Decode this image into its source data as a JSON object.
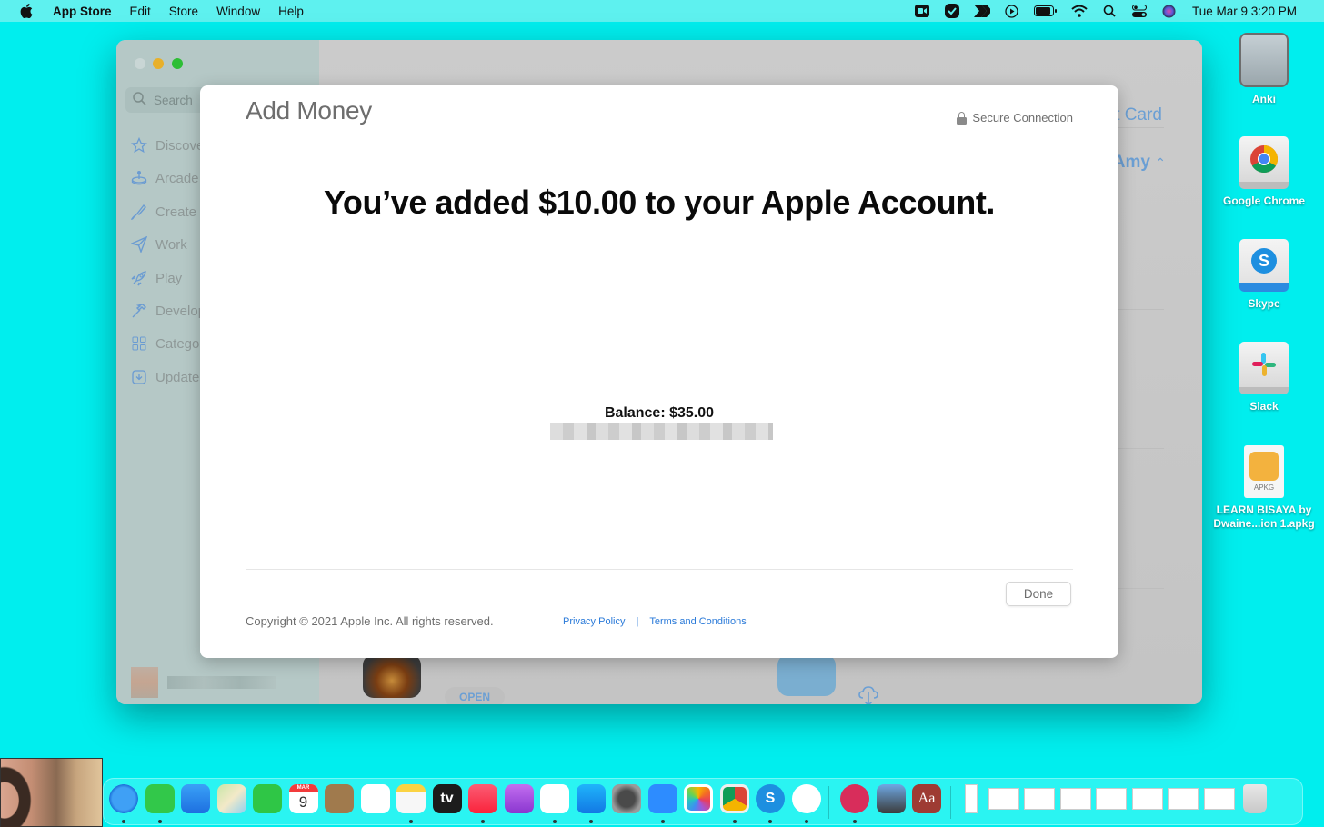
{
  "menubar": {
    "app_name": "App Store",
    "items": [
      "Edit",
      "Store",
      "Window",
      "Help"
    ],
    "clock": "Tue Mar 9  3:20 PM",
    "status_icons": [
      "zoom-icon",
      "tasks-check-icon",
      "skitch-icon",
      "play-circle-icon",
      "battery-icon",
      "wifi-icon",
      "spotlight-search-icon",
      "control-center-icon",
      "siri-icon"
    ]
  },
  "app_window": {
    "sidebar": {
      "search_placeholder": "Search",
      "items": [
        {
          "label": "Discover",
          "icon": "star-icon"
        },
        {
          "label": "Arcade",
          "icon": "joystick-icon"
        },
        {
          "label": "Create",
          "icon": "brush-icon"
        },
        {
          "label": "Work",
          "icon": "paper-plane-icon"
        },
        {
          "label": "Play",
          "icon": "rocket-icon"
        },
        {
          "label": "Develop",
          "icon": "hammer-icon"
        },
        {
          "label": "Categories",
          "icon": "grid-icon"
        },
        {
          "label": "Updates",
          "icon": "download-tray-icon"
        }
      ]
    },
    "main": {
      "gift_card_link": "t Card",
      "account_name": "Amy",
      "open_button": "OPEN"
    }
  },
  "modal": {
    "title": "Add Money",
    "secure_label": "Secure Connection",
    "headline": "You’ve added $10.00 to your Apple Account.",
    "balance": "Balance: $35.00",
    "done_label": "Done",
    "copyright": "Copyright © 2021 Apple Inc. All rights reserved.",
    "privacy_link": "Privacy Policy",
    "link_separator": "|",
    "terms_link": "Terms and Conditions"
  },
  "desktop_icons": [
    {
      "label": "Anki",
      "type": "hard-drive"
    },
    {
      "label": "Google Chrome",
      "type": "disk-image"
    },
    {
      "label": "Skype",
      "type": "disk-image"
    },
    {
      "label": "Slack",
      "type": "disk-image"
    },
    {
      "label": "LEARN BISAYA by Dwaine...ion 1.apkg",
      "type": "file",
      "ext": "APKG"
    }
  ],
  "dock": {
    "apps": [
      {
        "name": "Safari",
        "running": true
      },
      {
        "name": "Messages",
        "running": true
      },
      {
        "name": "Mail",
        "running": false
      },
      {
        "name": "Maps",
        "running": false
      },
      {
        "name": "FaceTime",
        "running": false
      },
      {
        "name": "Calendar",
        "running": false,
        "month": "MAR",
        "day": "9"
      },
      {
        "name": "Notefile",
        "running": false
      },
      {
        "name": "Reminders",
        "running": false
      },
      {
        "name": "Notes",
        "running": true
      },
      {
        "name": "TV",
        "running": false,
        "text": "tv"
      },
      {
        "name": "Music",
        "running": true
      },
      {
        "name": "Podcasts",
        "running": false
      },
      {
        "name": "News",
        "running": true
      },
      {
        "name": "App Store",
        "running": true
      },
      {
        "name": "System Preferences",
        "running": false
      },
      {
        "name": "Zoom",
        "running": true
      },
      {
        "name": "Photos",
        "running": false
      },
      {
        "name": "Google Chrome",
        "running": true
      },
      {
        "name": "Skype",
        "running": true
      },
      {
        "name": "Slack",
        "running": true
      },
      {
        "name": "Skitch",
        "running": true
      },
      {
        "name": "Anki",
        "running": false
      },
      {
        "name": "Dictionary",
        "running": false,
        "text": "Aa"
      }
    ],
    "minimized_windows": 8,
    "trash": "Trash"
  }
}
